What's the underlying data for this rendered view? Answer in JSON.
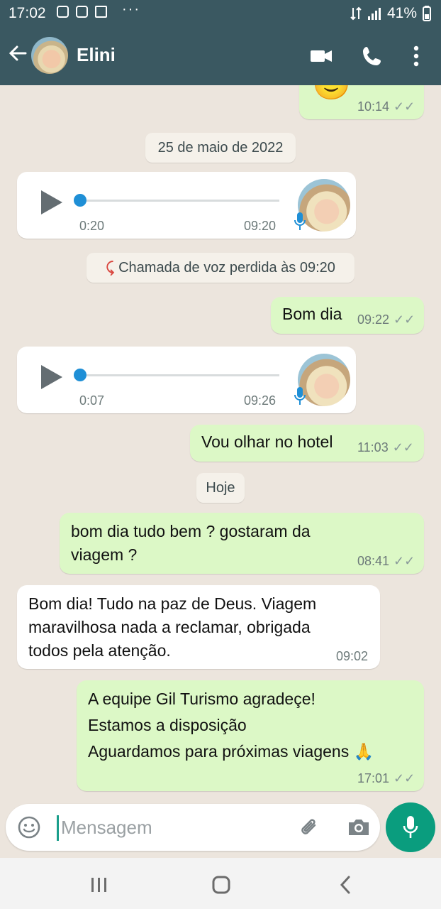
{
  "status": {
    "time": "17:02",
    "battery": "41%",
    "notification_icons": [
      "instagram-icon",
      "mail-app-icon",
      "envelope-icon"
    ],
    "more": "···"
  },
  "header": {
    "contact_name": "Elini",
    "icons": [
      "back-arrow-icon",
      "video-call-icon",
      "phone-icon",
      "more-vert-icon"
    ]
  },
  "chat": {
    "top_message": {
      "emoji": "🙂",
      "time": "10:14"
    },
    "date_chip_1": "25 de maio de 2022",
    "voice_1": {
      "duration": "0:20",
      "time": "09:20"
    },
    "missed_call": "Chamada de voz perdida às 09:20",
    "msg_bom_dia": {
      "text": "Bom dia",
      "time": "09:22"
    },
    "voice_2": {
      "duration": "0:07",
      "time": "09:26"
    },
    "msg_hotel": {
      "text": "Vou olhar no hotel",
      "time": "11:03"
    },
    "date_chip_2": "Hoje",
    "msg_viagem": {
      "text": "bom dia tudo bem ? gostaram da\nviagem ?",
      "time": "08:41"
    },
    "msg_reply": {
      "text": "Bom dia! Tudo na paz de Deus. Viagem\nmaravilhosa nada a reclamar, obrigada\ntodos pela atenção.",
      "time": "09:02"
    },
    "msg_thanks": {
      "text": "A equipe Gil Turismo agradeçe!\nEstamos a disposição\nAguardamos para próximas viagens 🙏",
      "time": "17:01"
    }
  },
  "composer": {
    "placeholder": "Mensagem"
  },
  "colors": {
    "header": "#3a5861",
    "outgoing": "#dcf8c6",
    "incoming": "#ffffff",
    "accent": "#0a9d7e",
    "link_blue": "#1f8fd6"
  }
}
